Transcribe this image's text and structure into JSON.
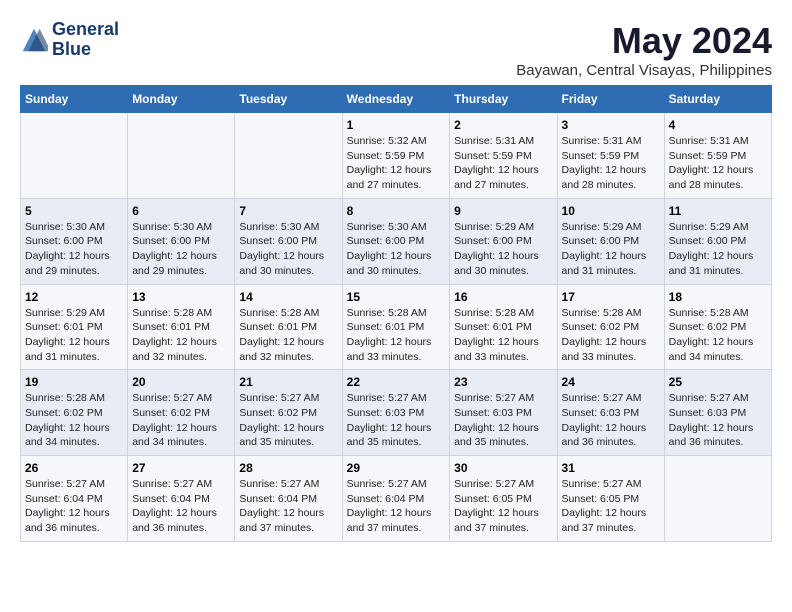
{
  "header": {
    "logo_line1": "General",
    "logo_line2": "Blue",
    "month_title": "May 2024",
    "location": "Bayawan, Central Visayas, Philippines"
  },
  "days_of_week": [
    "Sunday",
    "Monday",
    "Tuesday",
    "Wednesday",
    "Thursday",
    "Friday",
    "Saturday"
  ],
  "weeks": [
    [
      {
        "day": null,
        "sunrise": null,
        "sunset": null,
        "daylight": null
      },
      {
        "day": null,
        "sunrise": null,
        "sunset": null,
        "daylight": null
      },
      {
        "day": null,
        "sunrise": null,
        "sunset": null,
        "daylight": null
      },
      {
        "day": 1,
        "sunrise": "5:32 AM",
        "sunset": "5:59 PM",
        "daylight": "12 hours and 27 minutes."
      },
      {
        "day": 2,
        "sunrise": "5:31 AM",
        "sunset": "5:59 PM",
        "daylight": "12 hours and 27 minutes."
      },
      {
        "day": 3,
        "sunrise": "5:31 AM",
        "sunset": "5:59 PM",
        "daylight": "12 hours and 28 minutes."
      },
      {
        "day": 4,
        "sunrise": "5:31 AM",
        "sunset": "5:59 PM",
        "daylight": "12 hours and 28 minutes."
      }
    ],
    [
      {
        "day": 5,
        "sunrise": "5:30 AM",
        "sunset": "6:00 PM",
        "daylight": "12 hours and 29 minutes."
      },
      {
        "day": 6,
        "sunrise": "5:30 AM",
        "sunset": "6:00 PM",
        "daylight": "12 hours and 29 minutes."
      },
      {
        "day": 7,
        "sunrise": "5:30 AM",
        "sunset": "6:00 PM",
        "daylight": "12 hours and 30 minutes."
      },
      {
        "day": 8,
        "sunrise": "5:30 AM",
        "sunset": "6:00 PM",
        "daylight": "12 hours and 30 minutes."
      },
      {
        "day": 9,
        "sunrise": "5:29 AM",
        "sunset": "6:00 PM",
        "daylight": "12 hours and 30 minutes."
      },
      {
        "day": 10,
        "sunrise": "5:29 AM",
        "sunset": "6:00 PM",
        "daylight": "12 hours and 31 minutes."
      },
      {
        "day": 11,
        "sunrise": "5:29 AM",
        "sunset": "6:00 PM",
        "daylight": "12 hours and 31 minutes."
      }
    ],
    [
      {
        "day": 12,
        "sunrise": "5:29 AM",
        "sunset": "6:01 PM",
        "daylight": "12 hours and 31 minutes."
      },
      {
        "day": 13,
        "sunrise": "5:28 AM",
        "sunset": "6:01 PM",
        "daylight": "12 hours and 32 minutes."
      },
      {
        "day": 14,
        "sunrise": "5:28 AM",
        "sunset": "6:01 PM",
        "daylight": "12 hours and 32 minutes."
      },
      {
        "day": 15,
        "sunrise": "5:28 AM",
        "sunset": "6:01 PM",
        "daylight": "12 hours and 33 minutes."
      },
      {
        "day": 16,
        "sunrise": "5:28 AM",
        "sunset": "6:01 PM",
        "daylight": "12 hours and 33 minutes."
      },
      {
        "day": 17,
        "sunrise": "5:28 AM",
        "sunset": "6:02 PM",
        "daylight": "12 hours and 33 minutes."
      },
      {
        "day": 18,
        "sunrise": "5:28 AM",
        "sunset": "6:02 PM",
        "daylight": "12 hours and 34 minutes."
      }
    ],
    [
      {
        "day": 19,
        "sunrise": "5:28 AM",
        "sunset": "6:02 PM",
        "daylight": "12 hours and 34 minutes."
      },
      {
        "day": 20,
        "sunrise": "5:27 AM",
        "sunset": "6:02 PM",
        "daylight": "12 hours and 34 minutes."
      },
      {
        "day": 21,
        "sunrise": "5:27 AM",
        "sunset": "6:02 PM",
        "daylight": "12 hours and 35 minutes."
      },
      {
        "day": 22,
        "sunrise": "5:27 AM",
        "sunset": "6:03 PM",
        "daylight": "12 hours and 35 minutes."
      },
      {
        "day": 23,
        "sunrise": "5:27 AM",
        "sunset": "6:03 PM",
        "daylight": "12 hours and 35 minutes."
      },
      {
        "day": 24,
        "sunrise": "5:27 AM",
        "sunset": "6:03 PM",
        "daylight": "12 hours and 36 minutes."
      },
      {
        "day": 25,
        "sunrise": "5:27 AM",
        "sunset": "6:03 PM",
        "daylight": "12 hours and 36 minutes."
      }
    ],
    [
      {
        "day": 26,
        "sunrise": "5:27 AM",
        "sunset": "6:04 PM",
        "daylight": "12 hours and 36 minutes."
      },
      {
        "day": 27,
        "sunrise": "5:27 AM",
        "sunset": "6:04 PM",
        "daylight": "12 hours and 36 minutes."
      },
      {
        "day": 28,
        "sunrise": "5:27 AM",
        "sunset": "6:04 PM",
        "daylight": "12 hours and 37 minutes."
      },
      {
        "day": 29,
        "sunrise": "5:27 AM",
        "sunset": "6:04 PM",
        "daylight": "12 hours and 37 minutes."
      },
      {
        "day": 30,
        "sunrise": "5:27 AM",
        "sunset": "6:05 PM",
        "daylight": "12 hours and 37 minutes."
      },
      {
        "day": 31,
        "sunrise": "5:27 AM",
        "sunset": "6:05 PM",
        "daylight": "12 hours and 37 minutes."
      },
      {
        "day": null,
        "sunrise": null,
        "sunset": null,
        "daylight": null
      }
    ]
  ]
}
